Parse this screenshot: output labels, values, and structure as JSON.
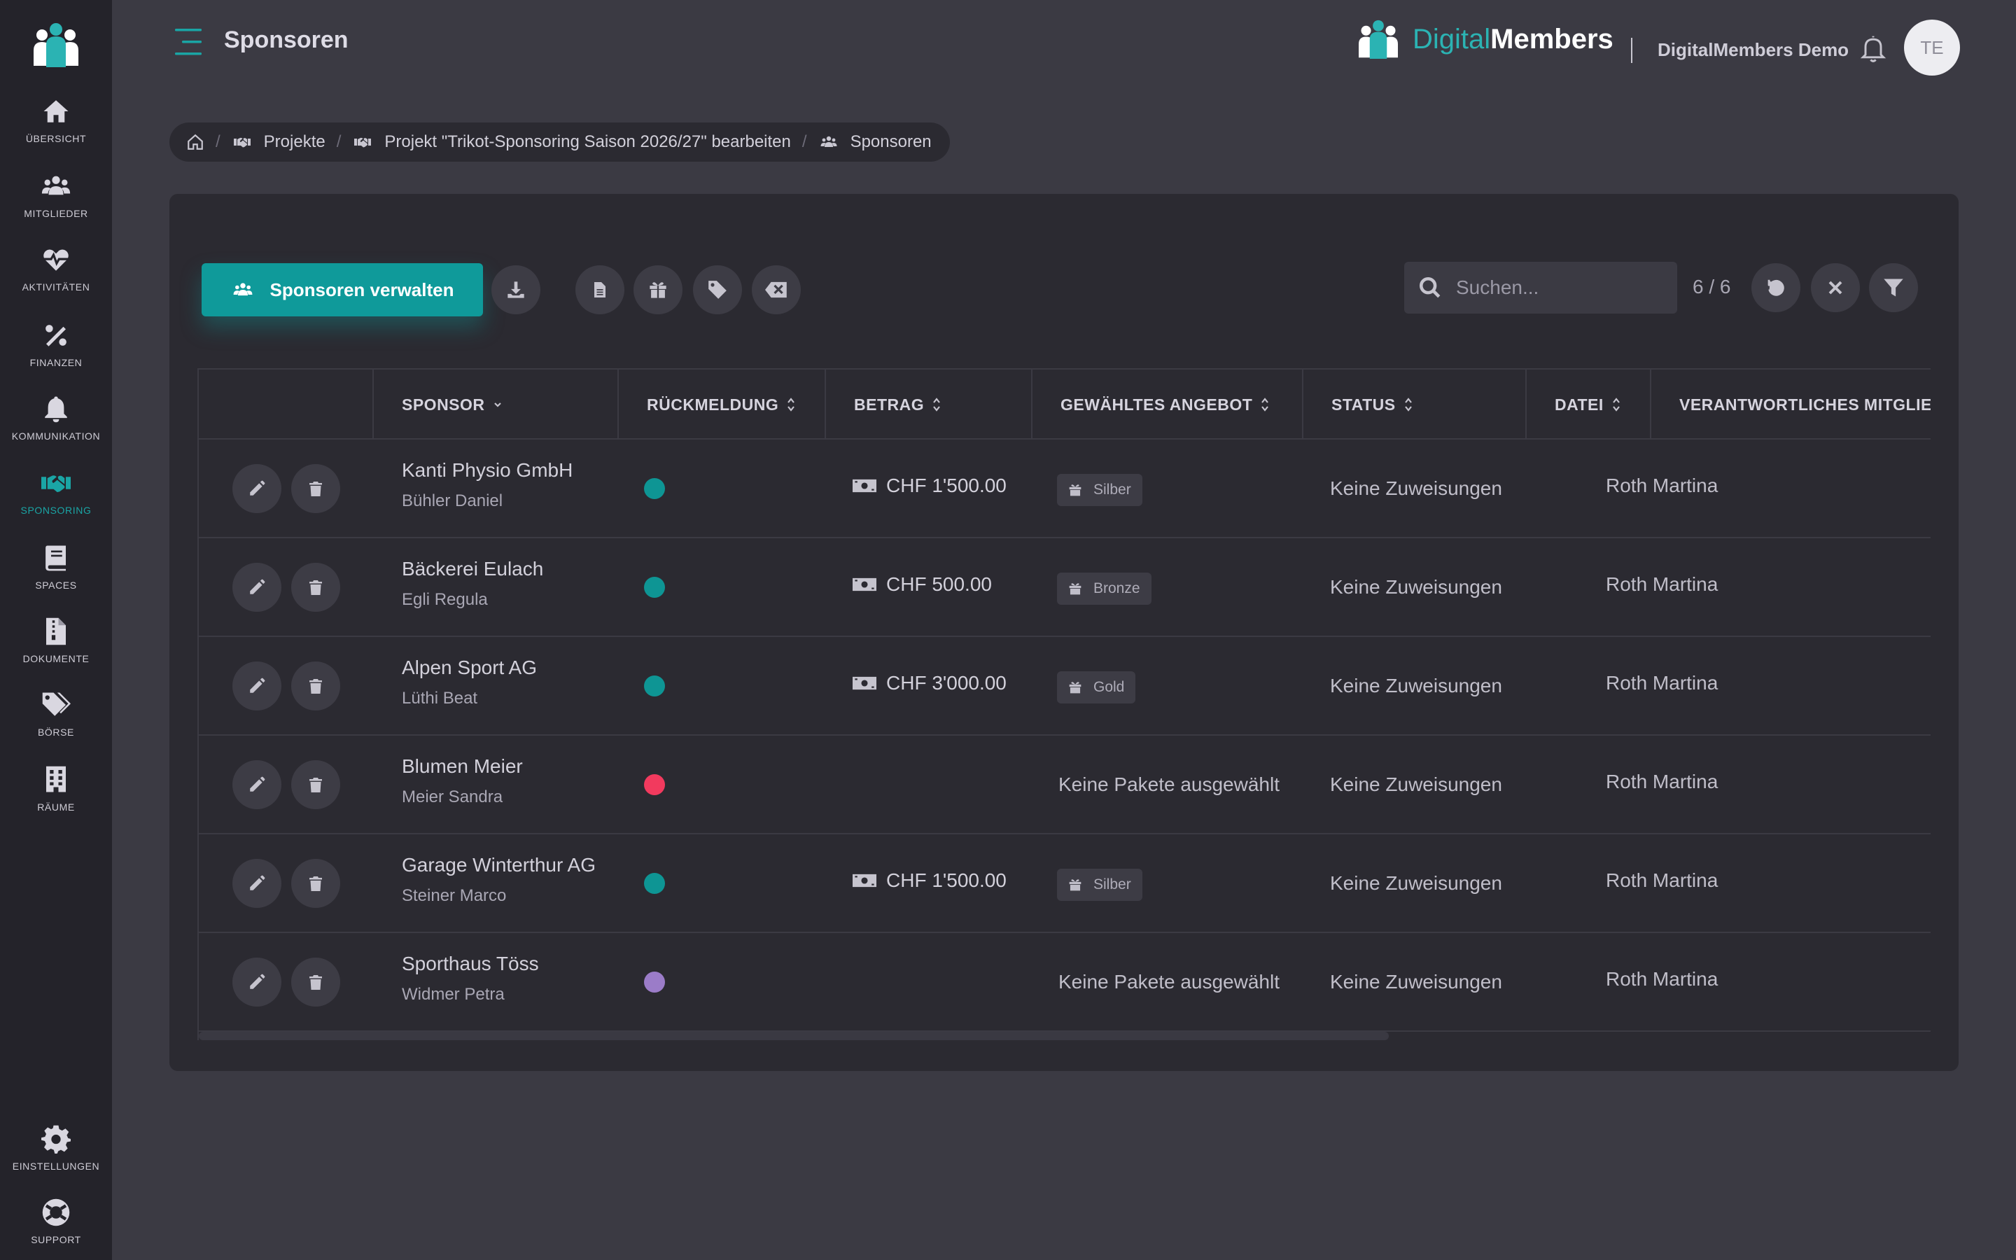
{
  "sidebar": {
    "items": [
      {
        "label": "ÜBERSICHT",
        "icon": "home-icon"
      },
      {
        "label": "MITGLIEDER",
        "icon": "users-icon"
      },
      {
        "label": "AKTIVITÄTEN",
        "icon": "heartbeat-icon"
      },
      {
        "label": "FINANZEN",
        "icon": "percent-icon"
      },
      {
        "label": "KOMMUNIKATION",
        "icon": "bell-icon"
      },
      {
        "label": "SPONSORING",
        "icon": "handshake-icon",
        "active": true
      },
      {
        "label": "SPACES",
        "icon": "book-icon"
      },
      {
        "label": "DOKUMENTE",
        "icon": "file-zip-icon"
      },
      {
        "label": "BÖRSE",
        "icon": "tags-icon"
      },
      {
        "label": "RÄUME",
        "icon": "building-icon"
      }
    ],
    "bottom": [
      {
        "label": "EINSTELLUNGEN",
        "icon": "gear-icon"
      },
      {
        "label": "SUPPORT",
        "icon": "lifebuoy-icon"
      }
    ]
  },
  "header": {
    "title": "Sponsoren",
    "brand_part1": "Digital",
    "brand_part2": "Members",
    "org_name": "DigitalMembers Demo",
    "avatar_initials": "TE"
  },
  "breadcrumb": {
    "items": [
      "Projekte",
      "Projekt \"Trikot-Sponsoring Saison 2026/27\" bearbeiten",
      "Sponsoren"
    ]
  },
  "toolbar": {
    "primary_label": "Sponsoren verwalten",
    "search_placeholder": "Suchen...",
    "count": "6 / 6"
  },
  "table": {
    "headers": [
      "SPONSOR",
      "RÜCKMELDUNG",
      "BETRAG",
      "GEWÄHLTES ANGEBOT",
      "STATUS",
      "DATEI",
      "VERANTWORTLICHES MITGLIED"
    ],
    "rows": [
      {
        "name": "Kanti Physio GmbH",
        "contact": "Bühler Daniel",
        "response_color": "#0e9594",
        "amount": "CHF 1'500.00",
        "package": "Silber",
        "status": "Keine Zuweisungen",
        "member": "Roth Martina"
      },
      {
        "name": "Bäckerei Eulach",
        "contact": "Egli Regula",
        "response_color": "#0e9594",
        "amount": "CHF 500.00",
        "package": "Bronze",
        "status": "Keine Zuweisungen",
        "member": "Roth Martina"
      },
      {
        "name": "Alpen Sport AG",
        "contact": "Lüthi Beat",
        "response_color": "#0e9594",
        "amount": "CHF 3'000.00",
        "package": "Gold",
        "status": "Keine Zuweisungen",
        "member": "Roth Martina"
      },
      {
        "name": "Blumen Meier",
        "contact": "Meier Sandra",
        "response_color": "#f23a5e",
        "amount": "",
        "package": "",
        "no_package": "Keine Pakete ausgewählt",
        "status": "Keine Zuweisungen",
        "member": "Roth Martina"
      },
      {
        "name": "Garage Winterthur AG",
        "contact": "Steiner Marco",
        "response_color": "#0e9594",
        "amount": "CHF 1'500.00",
        "package": "Silber",
        "status": "Keine Zuweisungen",
        "member": "Roth Martina"
      },
      {
        "name": "Sporthaus Töss",
        "contact": "Widmer Petra",
        "response_color": "#9b7cc8",
        "amount": "",
        "package": "",
        "no_package": "Keine Pakete ausgewählt",
        "status": "Keine Zuweisungen",
        "member": "Roth Martina"
      }
    ]
  },
  "colors": {
    "accent": "#0f9a9a",
    "sidebar_bg": "#24232a",
    "page_bg": "#3b3a43",
    "card_bg": "#2b2a31"
  }
}
